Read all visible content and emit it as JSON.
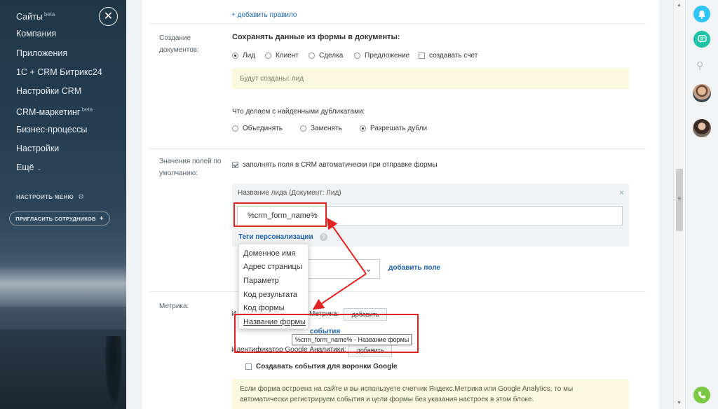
{
  "sidebar": {
    "nav": [
      {
        "label": "Сайты",
        "badge": "beta"
      },
      {
        "label": "Компания",
        "badge": ""
      },
      {
        "label": "Приложения",
        "badge": ""
      },
      {
        "label": "1С + CRM Битрикс24",
        "badge": ""
      },
      {
        "label": "Настройки CRM",
        "badge": ""
      },
      {
        "label": "CRM-маркетинг",
        "badge": "beta"
      },
      {
        "label": "Бизнес-процессы",
        "badge": ""
      },
      {
        "label": "Настройки",
        "badge": ""
      },
      {
        "label": "Ещё",
        "badge": ""
      }
    ],
    "more_chevron": "⌄",
    "setup_menu": "НАСТРОИТЬ МЕНЮ",
    "invite": "ПРИГЛАСИТЬ СОТРУДНИКОВ",
    "close_glyph": "✕"
  },
  "rules": {
    "add_rule": "+ добавить правило"
  },
  "documents": {
    "label": "Создание документов:",
    "title": "Сохранять данные из формы в документы:",
    "options": [
      "Лид",
      "Клиент",
      "Сделка",
      "Предложение"
    ],
    "selected": "Лид",
    "invoice_checkbox": "создавать счет",
    "note": "Будут созданы: лид",
    "duplicates_title": "Что делаем с найденными дубликатами:",
    "duplicate_options": [
      "Объединять",
      "Заменять",
      "Разрешать дубли"
    ],
    "duplicate_selected": "Разрешать дубли"
  },
  "defaults": {
    "label": "Значения полей по умолчанию:",
    "autofill_checkbox": "заполнять поля в CRM автоматически при отправке формы",
    "field_title": "Название лида (Документ: Лид)",
    "close_glyph": "×",
    "field_value": "%crm_form_name%",
    "tags_link": "Теги персонализации",
    "help_glyph": "?",
    "add_field": "добавить поле",
    "select_chevron": "⌄"
  },
  "dropdown": {
    "items": [
      "Доменное имя",
      "Адрес страницы",
      "Параметр",
      "Код результата",
      "Код формы",
      "Название формы"
    ],
    "active": "Название формы"
  },
  "tooltip": "%crm_form_name% - Название формы",
  "metrika": {
    "label": "Метрика:",
    "yandex_prefix": "И",
    "yandex_suffix": "Метрика:",
    "add_button": "добавить",
    "events_link": "события",
    "google_label": "Идентификатор Google Аналитики:",
    "google_add_button": "добавить",
    "google_events_checkbox": "Создавать события для воронки Google",
    "note": "Если форма встроена на сайте и вы используете счетчик Яндекс.Метрика или Google Analytics, то мы автоматически регистрируем события и цели формы без указания настроек в этом блоке."
  },
  "colors": {
    "accent_link": "#2067b0",
    "annotation_red": "#e02424",
    "notify_blue": "#2fc6f6",
    "chat_green": "#1fc3a5",
    "call_green": "#7ac943"
  },
  "right_panel": {
    "icons": [
      "bell-icon",
      "chat-icon",
      "search-icon",
      "avatar-1",
      "avatar-2",
      "phone-icon"
    ]
  }
}
